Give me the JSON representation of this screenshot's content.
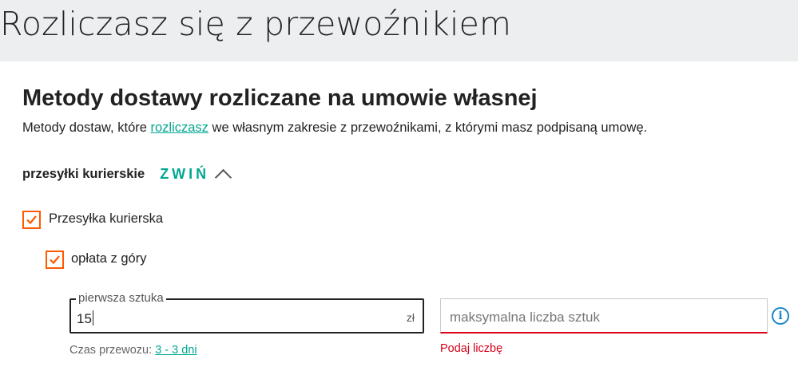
{
  "header": {
    "title": "Rozliczasz się z przewoźnikiem"
  },
  "section": {
    "title": "Metody dostawy rozliczane na umowie własnej",
    "desc_before": "Metody dostaw, które ",
    "desc_link": "rozliczasz",
    "desc_after": " we własnym zakresie z przewoźnikami, z którymi masz podpisaną umowę."
  },
  "group": {
    "label": "przesyłki kurierskie",
    "collapse_label": "ZWIŃ",
    "icon": "chevron-up-icon"
  },
  "checkboxes": {
    "courier": {
      "label": "Przesyłka kurierska",
      "checked": true
    },
    "prepaid": {
      "label": "opłata z góry",
      "checked": true
    }
  },
  "first_item": {
    "legend": "pierwsza sztuka",
    "value": "15",
    "unit": "zł"
  },
  "max_items": {
    "placeholder": "maksymalna liczba sztuk",
    "error": "Podaj liczbę"
  },
  "delivery": {
    "label": "Czas przewozu: ",
    "link": "3 - 3 dni"
  },
  "colors": {
    "accent": "#00a790",
    "checkbox": "#ff5a00",
    "error": "#d4001a",
    "info": "#1a86c8"
  }
}
